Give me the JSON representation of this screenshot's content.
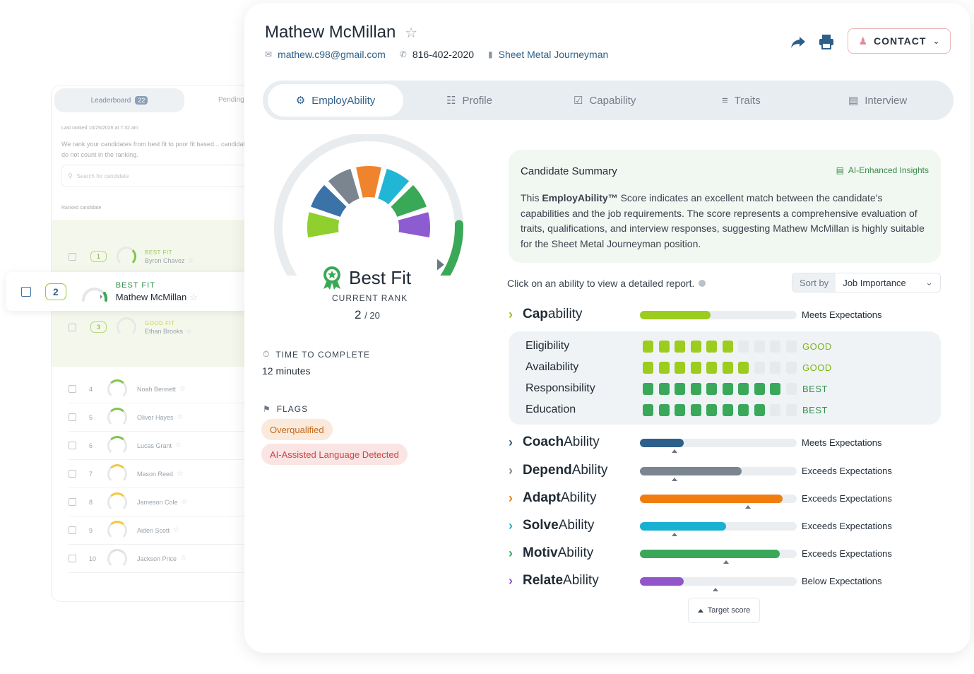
{
  "leaderboard": {
    "tab_label": "Leaderboard",
    "tab_count": "22",
    "pending_label": "Pending",
    "last_ranked": "Last ranked 10/25/2026 at 7:32 am",
    "description": "We rank your candidates from best fit to poor fit based... candidates do not count in the ranking.",
    "search_placeholder": "Search for candidate",
    "ranked_header": "Ranked candidate",
    "top_rows": [
      {
        "rank": "1",
        "fit": "BEST FIT",
        "name": "Byron Chavez"
      },
      {
        "rank": "2",
        "fit": "BEST FIT",
        "name": "Mathew McMillan"
      },
      {
        "rank": "3",
        "fit": "GOOD FIT",
        "name": "Ethan Brooks"
      }
    ],
    "rows": [
      {
        "rank": "4",
        "name": "Noah Bennett"
      },
      {
        "rank": "5",
        "name": "Oliver Hayes"
      },
      {
        "rank": "6",
        "name": "Lucas Grant"
      },
      {
        "rank": "7",
        "name": "Mason Reed"
      },
      {
        "rank": "8",
        "name": "Jameson Cole"
      },
      {
        "rank": "9",
        "name": "Aiden Scott"
      },
      {
        "rank": "10",
        "name": "Jackson Price"
      }
    ]
  },
  "candidate": {
    "name": "Mathew McMillan",
    "email": "mathew.c98@gmail.com",
    "phone": "816-402-2020",
    "job": "Sheet Metal Journeyman",
    "contact_button": "CONTACT"
  },
  "tabs": [
    {
      "label": "EmployAbility",
      "icon": "employability-icon"
    },
    {
      "label": "Profile",
      "icon": "profile-icon"
    },
    {
      "label": "Capability",
      "icon": "capability-icon"
    },
    {
      "label": "Traits",
      "icon": "traits-icon"
    },
    {
      "label": "Interview",
      "icon": "interview-icon"
    }
  ],
  "gauge": {
    "fit_label": "Best Fit",
    "rank_label": "CURRENT RANK",
    "rank": "2",
    "rank_total": "/ 20",
    "segment_colors": [
      "#8fcf2e",
      "#3b72a8",
      "#7a8590",
      "#f0842c",
      "#22b6d6",
      "#3aa957",
      "#8d5cd0"
    ],
    "arc_color": "#3aa957",
    "score_fraction": 0.84
  },
  "time": {
    "label": "TIME TO COMPLETE",
    "value": "12 minutes"
  },
  "flags": {
    "label": "FLAGS",
    "items": [
      {
        "text": "Overqualified",
        "bg": "#fbeadb",
        "fg": "#c46a1e"
      },
      {
        "text": "AI-Assisted Language Detected",
        "bg": "#fbe4e4",
        "fg": "#c74646"
      }
    ]
  },
  "summary": {
    "title": "Candidate Summary",
    "ai_label": "AI-Enhanced Insights",
    "text_pre": "This ",
    "text_bold": "EmployAbility™",
    "text_post": " Score indicates an excellent match between the candidate's capabilities and the job requirements. The score represents a comprehensive evaluation of traits, qualifications, and interview responses, suggesting Mathew McMillan is highly suitable for the Sheet Metal Journeyman position."
  },
  "abilities_header": {
    "instruction": "Click on an ability to view a detailed report.",
    "sort_label": "Sort by",
    "sort_value": "Job Importance"
  },
  "abilities": [
    {
      "bold": "Cap",
      "rest": "ability",
      "status": "Meets Expectations",
      "score": 0.45,
      "target": null,
      "color": "#9ccc1e",
      "chev": "#8fc31f"
    },
    {
      "bold": "Coach",
      "rest": "Ability",
      "status": "Meets Expectations",
      "score": 0.28,
      "target": 0.22,
      "color": "#2c5f8a",
      "chev": "#2c5f8a"
    },
    {
      "bold": "Depend",
      "rest": "Ability",
      "status": "Exceeds Expectations",
      "score": 0.65,
      "target": 0.22,
      "color": "#7a8590",
      "chev": "#7a8590"
    },
    {
      "bold": "Adapt",
      "rest": "Ability",
      "status": "Exceeds Expectations",
      "score": 0.91,
      "target": 0.69,
      "color": "#f07d0e",
      "chev": "#f07d0e"
    },
    {
      "bold": "Solve",
      "rest": "Ability",
      "status": "Exceeds Expectations",
      "score": 0.55,
      "target": 0.22,
      "color": "#19b0d2",
      "chev": "#19b0d2"
    },
    {
      "bold": "Motiv",
      "rest": "Ability",
      "status": "Exceeds Expectations",
      "score": 0.89,
      "target": 0.55,
      "color": "#39a85a",
      "chev": "#39a85a"
    },
    {
      "bold": "Relate",
      "rest": "Ability",
      "status": "Below Expectations",
      "score": 0.28,
      "target": 0.48,
      "color": "#9156c9",
      "chev": "#9156c9"
    }
  ],
  "capability_details": [
    {
      "name": "Eligibility",
      "filled": 6,
      "total": 10,
      "level": "GOOD",
      "color": "#9ccc1e",
      "level_color": "#7bb315"
    },
    {
      "name": "Availability",
      "filled": 7,
      "total": 10,
      "level": "GOOD",
      "color": "#9ccc1e",
      "level_color": "#7bb315"
    },
    {
      "name": "Responsibility",
      "filled": 9,
      "total": 10,
      "level": "BEST",
      "color": "#39a85a",
      "level_color": "#2f9150"
    },
    {
      "name": "Education",
      "filled": 8,
      "total": 10,
      "level": "BEST",
      "color": "#39a85a",
      "level_color": "#2f9150"
    }
  ],
  "legend": {
    "label": "Target score"
  }
}
